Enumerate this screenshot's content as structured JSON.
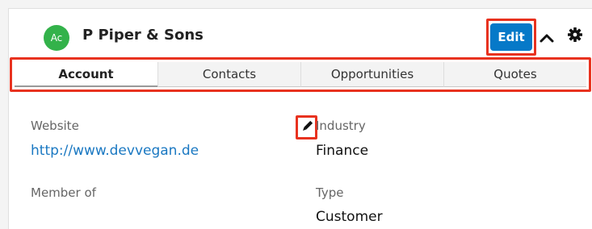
{
  "record": {
    "avatar_initials": "Ac",
    "name": "P Piper & Sons",
    "edit_label": "Edit"
  },
  "tabs": [
    {
      "label": "Account",
      "active": true
    },
    {
      "label": "Contacts",
      "active": false
    },
    {
      "label": "Opportunities",
      "active": false
    },
    {
      "label": "Quotes",
      "active": false
    }
  ],
  "fields": {
    "website_label": "Website",
    "website_value": "http://www.devvegan.de",
    "member_of_label": "Member of",
    "industry_label": "Industry",
    "industry_value": "Finance",
    "type_label": "Type",
    "type_value": "Customer"
  },
  "colors": {
    "avatar": "#33b24a",
    "edit_button": "#0679c8",
    "link": "#1a78c2",
    "highlight": "#e8321f"
  },
  "icons": [
    "chevron-up-icon",
    "gear-icon",
    "pencil-icon"
  ]
}
